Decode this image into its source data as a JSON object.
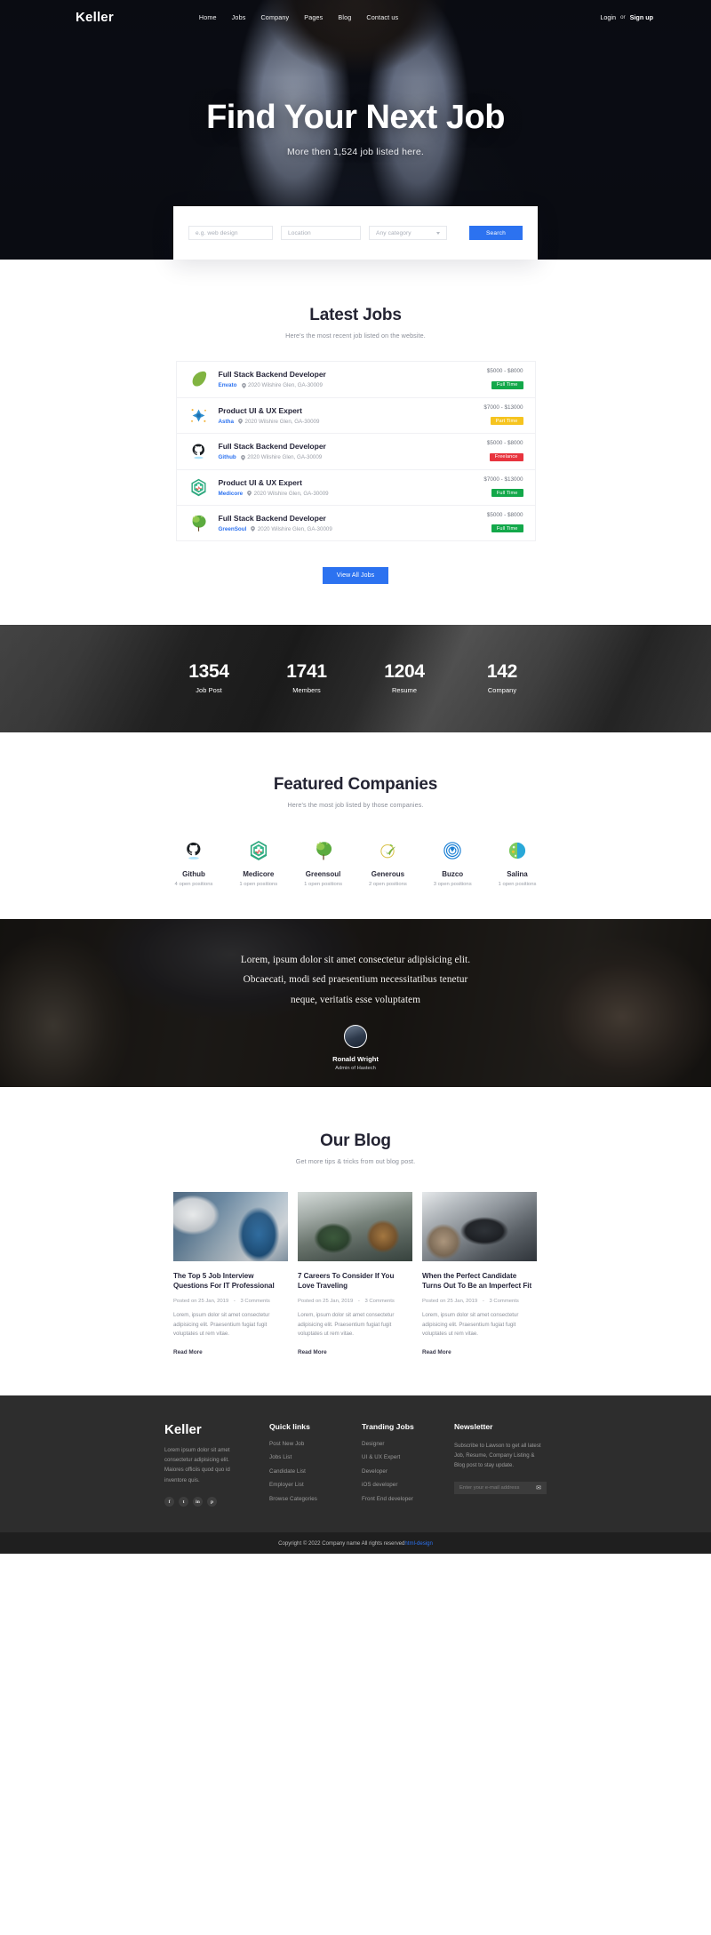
{
  "brand": "Keller",
  "nav": {
    "items": [
      "Home",
      "Jobs",
      "Company",
      "Pages",
      "Blog",
      "Contact us"
    ],
    "login": "Login",
    "or": "or",
    "signup": "Sign up"
  },
  "hero": {
    "title": "Find Your Next Job",
    "subtitle": "More then 1,524 job listed here."
  },
  "search": {
    "keyword_placeholder": "e.g. web design",
    "location_placeholder": "Location",
    "category_value": "Any category",
    "button_label": "Search"
  },
  "latest_jobs": {
    "title": "Latest Jobs",
    "subtitle": "Here's the most recent job listed on the website.",
    "view_all_label": "View All Jobs",
    "rows": [
      {
        "title": "Full Stack Backend Developer",
        "company": "Envato",
        "location": "2020 Wilshire Glen, GA-30009",
        "salary": "$5000 - $8000",
        "badge": "Full Time",
        "badge_type": "full",
        "logo": "envato-leaf-logo"
      },
      {
        "title": "Product UI & UX Expert",
        "company": "Astha",
        "location": "2020 Wilshire Glen, GA-30009",
        "salary": "$7000 - $13000",
        "badge": "Part Time",
        "badge_type": "part",
        "logo": "astha-star-logo"
      },
      {
        "title": "Full Stack Backend Developer",
        "company": "Github",
        "location": "2020 Wilshire Glen, GA-30009",
        "salary": "$5000 - $8000",
        "badge": "Freelance",
        "badge_type": "free",
        "logo": "github-octocat-logo"
      },
      {
        "title": "Product UI & UX Expert",
        "company": "Medicore",
        "location": "2020 Wilshire Glen, GA-30009",
        "salary": "$7000 - $13000",
        "badge": "Full Time",
        "badge_type": "full",
        "logo": "medicore-cross-logo"
      },
      {
        "title": "Full Stack Backend Developer",
        "company": "GreenSoul",
        "location": "2020 Wilshire Glen, GA-30009",
        "salary": "$5000 - $8000",
        "badge": "Full Time",
        "badge_type": "full",
        "logo": "greensoul-tree-logo"
      }
    ]
  },
  "counters": [
    {
      "num": "1354",
      "label": "Job Post"
    },
    {
      "num": "1741",
      "label": "Members"
    },
    {
      "num": "1204",
      "label": "Resume"
    },
    {
      "num": "142",
      "label": "Company"
    }
  ],
  "featured": {
    "title": "Featured Companies",
    "subtitle": "Here's the most job listed by those companies.",
    "companies": [
      {
        "name": "Github",
        "open": "4 open positions",
        "logo": "github-octocat-logo"
      },
      {
        "name": "Medicore",
        "open": "1 open positions",
        "logo": "medicore-cross-logo"
      },
      {
        "name": "Greensoul",
        "open": "1 open positions",
        "logo": "greensoul-tree-logo"
      },
      {
        "name": "Generous",
        "open": "2 open positions",
        "logo": "generous-leaf-logo"
      },
      {
        "name": "Buzco",
        "open": "3 open positions",
        "logo": "buzco-circle-logo"
      },
      {
        "name": "Salina",
        "open": "1 open positions",
        "logo": "salina-globe-logo"
      }
    ]
  },
  "testimonial": {
    "line1": "Lorem, ipsum dolor sit amet consectetur adipisicing elit.",
    "line2": "Obcaecati, modi sed praesentium necessitatibus tenetur",
    "line3": "neque, veritatis esse voluptatem",
    "name": "Ronald Wright",
    "role": "Admin of Hastech"
  },
  "blog": {
    "title": "Our Blog",
    "subtitle": "Get more tips & tricks from out blog post.",
    "posts": [
      {
        "title": "The Top 5 Job Interview Questions For IT Professional",
        "posted": "Posted on 25 Jan, 2019",
        "comments": "3 Comments",
        "excerpt": "Lorem, ipsum dolor sit amet consectetur adipisicing elit. Praesentium fugiat fugit voluptates ut rem vitae.",
        "read_more": "Read More",
        "thumb": "office-meeting-photo"
      },
      {
        "title": "7 Careers To Consider If You Love Traveling",
        "posted": "Posted on 25 Jan, 2019",
        "comments": "3 Comments",
        "excerpt": "Lorem, ipsum dolor sit amet consectetur adipisicing elit. Praesentium fugiat fugit voluptates ut rem vitae.",
        "read_more": "Read More",
        "thumb": "travelers-crowd-photo"
      },
      {
        "title": "When the Perfect Candidate Turns Out To Be an Imperfect Fit",
        "posted": "Posted on 25 Jan, 2019",
        "comments": "3 Comments",
        "excerpt": "Lorem, ipsum dolor sit amet consectetur adipisicing elit. Praesentium fugiat fugit voluptates ut rem vitae.",
        "read_more": "Read More",
        "thumb": "laptop-desk-photo"
      }
    ]
  },
  "footer": {
    "brand": "Keller",
    "desc": "Lorem ipsum dolor sit amet consectetur adipisicing elit. Maiores officiis quod quo id inventore quis.",
    "social": [
      "f",
      "t",
      "in",
      "p"
    ],
    "quick_links_title": "Quick links",
    "quick_links": [
      "Post New Job",
      "Jobs List",
      "Candidate List",
      "Employer List",
      "Browse Categories"
    ],
    "trending_title": "Tranding Jobs",
    "trending": [
      "Designer",
      "UI & UX Expert",
      "Developer",
      "iOS developer",
      "Front End developer"
    ],
    "newsletter_title": "Newsletter",
    "newsletter_text": "Subscribe to Lawson to get all latest Job, Resume, Company Listing & Blog post to stay update.",
    "newsletter_placeholder": "Enter your e-mail address",
    "copyright": "Copyright © 2022 Company name All rights reserved",
    "copyright_link": "html-design"
  },
  "colors": {
    "accent": "#2c72f0",
    "full_time": "#13a84a",
    "part_time": "#f6c41f",
    "freelance": "#e8343e",
    "footer_bg": "#2d2d2d"
  }
}
